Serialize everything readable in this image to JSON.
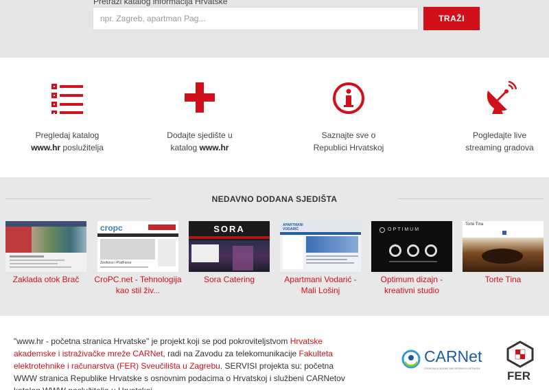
{
  "search": {
    "label": "Pretraži katalog informacija Hrvatske",
    "placeholder": "npr. Zagreb, apartman Pag...",
    "button": "TRAŽI"
  },
  "features": [
    {
      "icon": "list-icon",
      "line1": "Pregledaj katalog",
      "bold": "www.hr",
      "line2_rest": " poslužitelja"
    },
    {
      "icon": "plus-icon",
      "line1": "Dodajte sjedište u",
      "line2_pre": "katalog ",
      "bold": "www.hr"
    },
    {
      "icon": "info-icon",
      "line1": "Saznajte sve o",
      "line2": "Republici Hrvatskoj"
    },
    {
      "icon": "satellite-dish-icon",
      "line1": "Pogledajte live",
      "line2": "streaming gradova"
    }
  ],
  "recent": {
    "title": "NEDAVNO DODANA SJEDIŠTA",
    "sites": [
      {
        "name": "Zaklada otok Brač"
      },
      {
        "name": "CroPC.net - Tehnologija kao stil živ...",
        "thumb_logo": "cropc",
        "thumb_text": "Zeoforce i PodForce"
      },
      {
        "name": "Sora Catering",
        "thumb_logo": "SORA"
      },
      {
        "name": "Apartmani Vodarić - Mali Lošinj",
        "thumb_logo": "APARTMANI VODARIĆ"
      },
      {
        "name": "Optimum dizajn - kreativni studio",
        "thumb_logo": "OPTIMUM"
      },
      {
        "name": "Torte Tina",
        "thumb_logo": "Torte Tina"
      }
    ]
  },
  "footer": {
    "t1": "\"www.hr - početna stranica Hrvatske\" je projekt koji se pod pokroviteljstvom ",
    "l1": "Hrvatske akademske i istraživačke mreže CARNet",
    "t2": ", radi na Zavodu za telekomunikacije ",
    "l2": "Fakulteta elektrotehnike i računarstva (FER) Sveučilišta u Zagrebu",
    "t3": ". SERVISI projekta su: početna WWW stranica Republike Hrvatske s osnovnim podacima o Hrvatskoj i službeni CARNetov katalog WWW poslužitelja u Hrvatskoj.",
    "carnet_logo": "CARNet",
    "carnet_sub": "CROATIAN ACADEMIC AND RESEARCH NETWORK",
    "fer_logo": "FER"
  },
  "colors": {
    "accent": "#d0111b",
    "band": "#e6e6e6",
    "recent_bg": "#e8e8e8"
  }
}
